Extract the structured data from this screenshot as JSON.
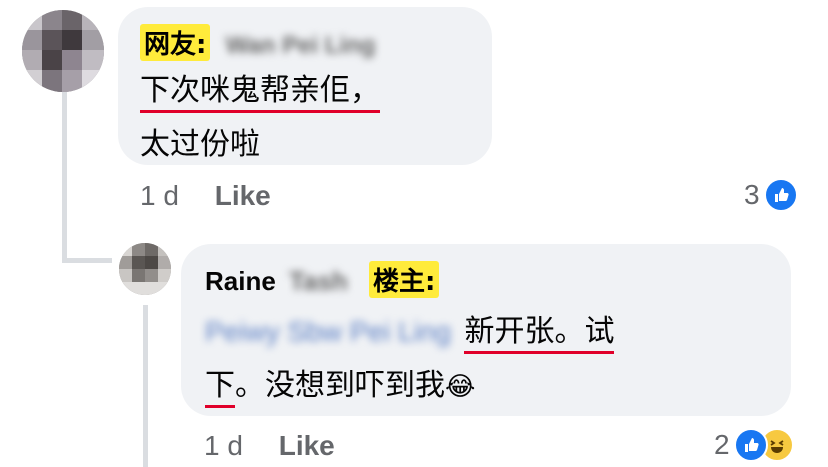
{
  "comment1": {
    "tag": "网友:",
    "name_blurred": "Wan Pei Ling",
    "line1": "下次咪鬼帮亲佢，",
    "line2": "太过份啦",
    "time": "1 d",
    "like_label": "Like",
    "reaction_count": "3"
  },
  "comment2": {
    "author": "Raine",
    "author_blurred": "Tash",
    "tag": "楼主:",
    "mention_blurred": "Peiwy Sbw Pei Ling",
    "line1_text": "新开张。试",
    "line2_text": "下。没想到吓到我",
    "emoji": "😂",
    "time": "1 d",
    "like_label": "Like",
    "reaction_count": "2"
  },
  "colors": {
    "bubble": "#f0f2f5",
    "tag_bg": "#ffeb3b",
    "underline": "#e0002a",
    "like_blue": "#1877f2",
    "meta_gray": "#65676b"
  }
}
